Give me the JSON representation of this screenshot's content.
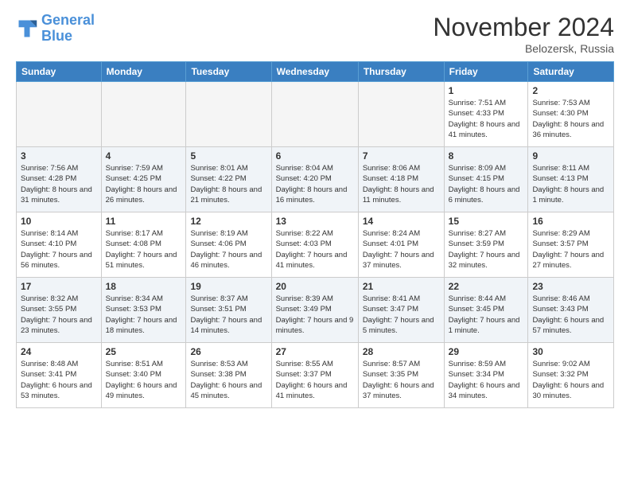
{
  "logo": {
    "line1": "General",
    "line2": "Blue"
  },
  "title": "November 2024",
  "subtitle": "Belozersk, Russia",
  "days_of_week": [
    "Sunday",
    "Monday",
    "Tuesday",
    "Wednesday",
    "Thursday",
    "Friday",
    "Saturday"
  ],
  "weeks": [
    [
      {
        "day": "",
        "info": ""
      },
      {
        "day": "",
        "info": ""
      },
      {
        "day": "",
        "info": ""
      },
      {
        "day": "",
        "info": ""
      },
      {
        "day": "",
        "info": ""
      },
      {
        "day": "1",
        "info": "Sunrise: 7:51 AM\nSunset: 4:33 PM\nDaylight: 8 hours and 41 minutes."
      },
      {
        "day": "2",
        "info": "Sunrise: 7:53 AM\nSunset: 4:30 PM\nDaylight: 8 hours and 36 minutes."
      }
    ],
    [
      {
        "day": "3",
        "info": "Sunrise: 7:56 AM\nSunset: 4:28 PM\nDaylight: 8 hours and 31 minutes."
      },
      {
        "day": "4",
        "info": "Sunrise: 7:59 AM\nSunset: 4:25 PM\nDaylight: 8 hours and 26 minutes."
      },
      {
        "day": "5",
        "info": "Sunrise: 8:01 AM\nSunset: 4:22 PM\nDaylight: 8 hours and 21 minutes."
      },
      {
        "day": "6",
        "info": "Sunrise: 8:04 AM\nSunset: 4:20 PM\nDaylight: 8 hours and 16 minutes."
      },
      {
        "day": "7",
        "info": "Sunrise: 8:06 AM\nSunset: 4:18 PM\nDaylight: 8 hours and 11 minutes."
      },
      {
        "day": "8",
        "info": "Sunrise: 8:09 AM\nSunset: 4:15 PM\nDaylight: 8 hours and 6 minutes."
      },
      {
        "day": "9",
        "info": "Sunrise: 8:11 AM\nSunset: 4:13 PM\nDaylight: 8 hours and 1 minute."
      }
    ],
    [
      {
        "day": "10",
        "info": "Sunrise: 8:14 AM\nSunset: 4:10 PM\nDaylight: 7 hours and 56 minutes."
      },
      {
        "day": "11",
        "info": "Sunrise: 8:17 AM\nSunset: 4:08 PM\nDaylight: 7 hours and 51 minutes."
      },
      {
        "day": "12",
        "info": "Sunrise: 8:19 AM\nSunset: 4:06 PM\nDaylight: 7 hours and 46 minutes."
      },
      {
        "day": "13",
        "info": "Sunrise: 8:22 AM\nSunset: 4:03 PM\nDaylight: 7 hours and 41 minutes."
      },
      {
        "day": "14",
        "info": "Sunrise: 8:24 AM\nSunset: 4:01 PM\nDaylight: 7 hours and 37 minutes."
      },
      {
        "day": "15",
        "info": "Sunrise: 8:27 AM\nSunset: 3:59 PM\nDaylight: 7 hours and 32 minutes."
      },
      {
        "day": "16",
        "info": "Sunrise: 8:29 AM\nSunset: 3:57 PM\nDaylight: 7 hours and 27 minutes."
      }
    ],
    [
      {
        "day": "17",
        "info": "Sunrise: 8:32 AM\nSunset: 3:55 PM\nDaylight: 7 hours and 23 minutes."
      },
      {
        "day": "18",
        "info": "Sunrise: 8:34 AM\nSunset: 3:53 PM\nDaylight: 7 hours and 18 minutes."
      },
      {
        "day": "19",
        "info": "Sunrise: 8:37 AM\nSunset: 3:51 PM\nDaylight: 7 hours and 14 minutes."
      },
      {
        "day": "20",
        "info": "Sunrise: 8:39 AM\nSunset: 3:49 PM\nDaylight: 7 hours and 9 minutes."
      },
      {
        "day": "21",
        "info": "Sunrise: 8:41 AM\nSunset: 3:47 PM\nDaylight: 7 hours and 5 minutes."
      },
      {
        "day": "22",
        "info": "Sunrise: 8:44 AM\nSunset: 3:45 PM\nDaylight: 7 hours and 1 minute."
      },
      {
        "day": "23",
        "info": "Sunrise: 8:46 AM\nSunset: 3:43 PM\nDaylight: 6 hours and 57 minutes."
      }
    ],
    [
      {
        "day": "24",
        "info": "Sunrise: 8:48 AM\nSunset: 3:41 PM\nDaylight: 6 hours and 53 minutes."
      },
      {
        "day": "25",
        "info": "Sunrise: 8:51 AM\nSunset: 3:40 PM\nDaylight: 6 hours and 49 minutes."
      },
      {
        "day": "26",
        "info": "Sunrise: 8:53 AM\nSunset: 3:38 PM\nDaylight: 6 hours and 45 minutes."
      },
      {
        "day": "27",
        "info": "Sunrise: 8:55 AM\nSunset: 3:37 PM\nDaylight: 6 hours and 41 minutes."
      },
      {
        "day": "28",
        "info": "Sunrise: 8:57 AM\nSunset: 3:35 PM\nDaylight: 6 hours and 37 minutes."
      },
      {
        "day": "29",
        "info": "Sunrise: 8:59 AM\nSunset: 3:34 PM\nDaylight: 6 hours and 34 minutes."
      },
      {
        "day": "30",
        "info": "Sunrise: 9:02 AM\nSunset: 3:32 PM\nDaylight: 6 hours and 30 minutes."
      }
    ]
  ]
}
